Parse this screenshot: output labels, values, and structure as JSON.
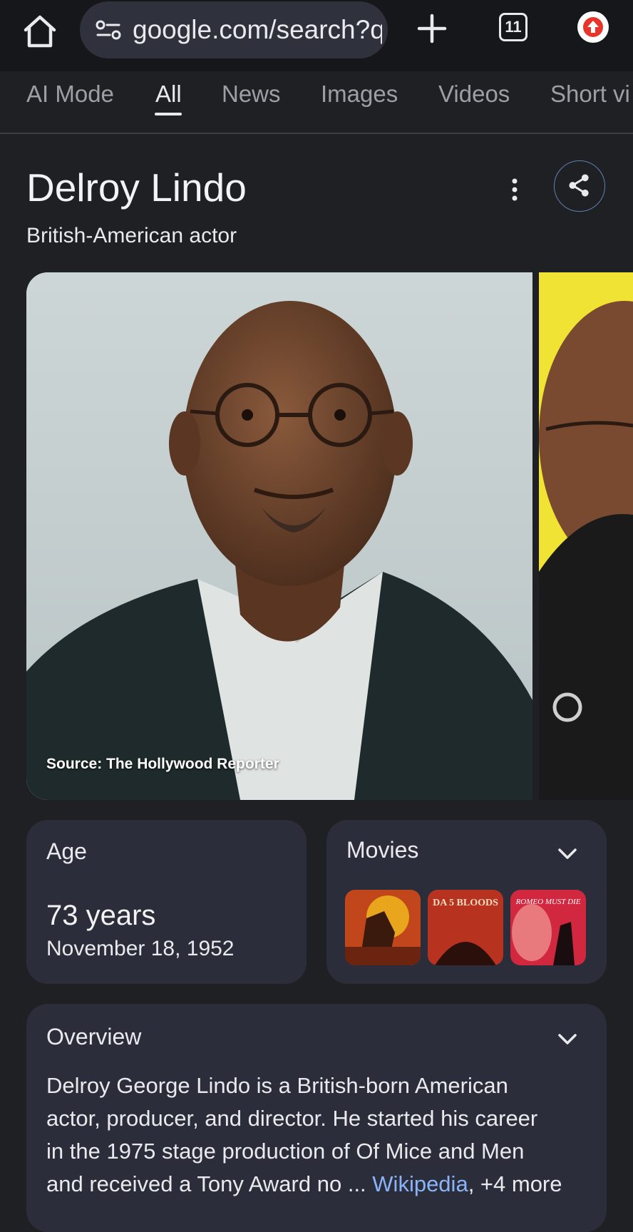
{
  "browser": {
    "url": "google.com/search?q",
    "tab_count": "11"
  },
  "search_tabs": [
    {
      "label": "AI Mode"
    },
    {
      "label": "All"
    },
    {
      "label": "News"
    },
    {
      "label": "Images"
    },
    {
      "label": "Videos"
    },
    {
      "label": "Short vi"
    }
  ],
  "entity": {
    "name": "Delroy Lindo",
    "description": "British-American actor",
    "image_source": "Source: The Hollywood Reporter"
  },
  "age_card": {
    "label": "Age",
    "value": "73 years",
    "birth_date": "November 18, 1952"
  },
  "movies_card": {
    "label": "Movies",
    "posters": [
      {
        "name": "movie-poster-1",
        "text": ""
      },
      {
        "name": "da-5-bloods-poster",
        "text": "DA 5 BLOODS"
      },
      {
        "name": "romeo-must-die-poster",
        "text": "ROMEO MUST DIE"
      }
    ]
  },
  "overview_card": {
    "label": "Overview",
    "lines": [
      "Delroy George Lindo is a British-born American",
      "actor, producer, and director. He started his career",
      "in the 1975 stage production of Of Mice and Men",
      "and received a Tony Award no"
    ],
    "ellipsis": "...",
    "source_link": "Wikipedia",
    "more": ", +4 more"
  },
  "colors": {
    "background": "#1f2023",
    "card": "#2b2e3a",
    "link": "#8ab4f8",
    "update_badge": "#e8352b"
  }
}
